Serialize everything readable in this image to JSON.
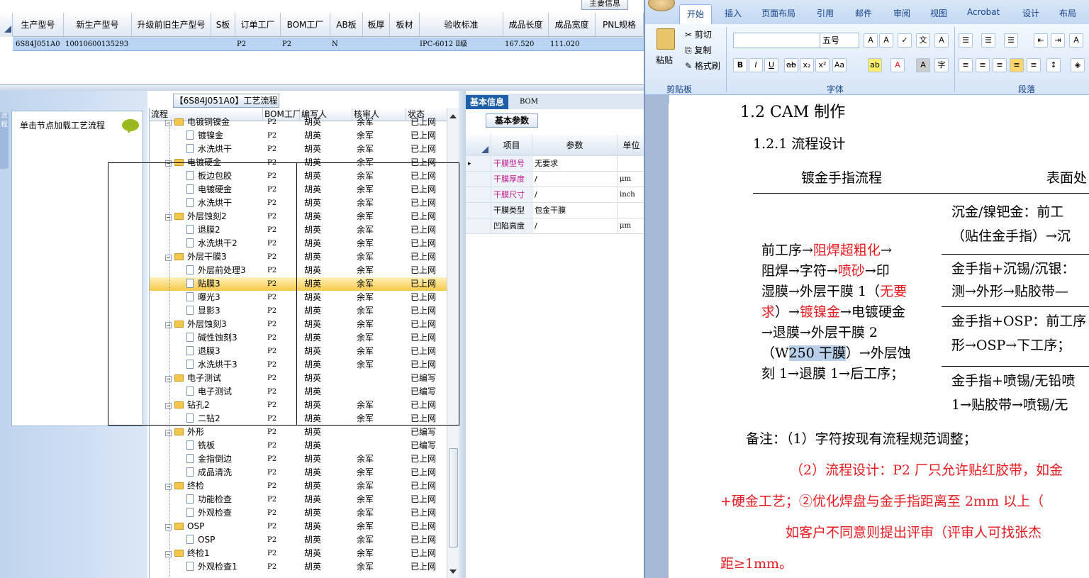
{
  "top_grid": {
    "tab": "主要信息",
    "headers": [
      "生产型号",
      "新生产型号",
      "升级前旧生产型号",
      "S板",
      "订单工厂",
      "BOM工厂",
      "AB板",
      "板厚",
      "板材",
      "验收标准",
      "成品长度",
      "成品宽度",
      "PNL规格"
    ],
    "row": [
      "6S84J051A0",
      "10010600135293",
      "",
      "",
      "P2",
      "P2",
      "N",
      "",
      "",
      "IPC-6012 Ⅱ级",
      "167.520",
      "111.020",
      ""
    ]
  },
  "left_panel": {
    "hint": "单击节点加载工艺流程",
    "side_tab": "流程"
  },
  "tree": {
    "title": "【6S84J051A0】工艺流程",
    "headers": [
      "流程",
      "BOM工厂",
      "编写人",
      "核审人",
      "状态"
    ],
    "rows": [
      {
        "level": 0,
        "type": "folder",
        "name": "电镀铜镍金",
        "bom": "P2",
        "writer": "胡英",
        "reviewer": "余军",
        "status": "已上网"
      },
      {
        "level": 1,
        "type": "doc",
        "name": "镀镍金",
        "bom": "P2",
        "writer": "胡英",
        "reviewer": "余军",
        "status": "已上网"
      },
      {
        "level": 1,
        "type": "doc",
        "name": "水洗烘干",
        "bom": "P2",
        "writer": "胡英",
        "reviewer": "余军",
        "status": "已上网"
      },
      {
        "level": 0,
        "type": "folder",
        "name": "电镀硬金",
        "bom": "P2",
        "writer": "胡英",
        "reviewer": "余军",
        "status": "已上网"
      },
      {
        "level": 1,
        "type": "doc",
        "name": "板边包胶",
        "bom": "P2",
        "writer": "胡英",
        "reviewer": "余军",
        "status": "已上网"
      },
      {
        "level": 1,
        "type": "doc",
        "name": "电镀硬金",
        "bom": "P2",
        "writer": "胡英",
        "reviewer": "余军",
        "status": "已上网"
      },
      {
        "level": 1,
        "type": "doc",
        "name": "水洗烘干",
        "bom": "P2",
        "writer": "胡英",
        "reviewer": "余军",
        "status": "已上网"
      },
      {
        "level": 0,
        "type": "folder",
        "name": "外层蚀刻2",
        "bom": "P2",
        "writer": "胡英",
        "reviewer": "余军",
        "status": "已上网"
      },
      {
        "level": 1,
        "type": "doc",
        "name": "退膜2",
        "bom": "P2",
        "writer": "胡英",
        "reviewer": "余军",
        "status": "已上网"
      },
      {
        "level": 1,
        "type": "doc",
        "name": "水洗烘干2",
        "bom": "P2",
        "writer": "胡英",
        "reviewer": "余军",
        "status": "已上网"
      },
      {
        "level": 0,
        "type": "folder",
        "name": "外层干膜3",
        "bom": "P2",
        "writer": "胡英",
        "reviewer": "余军",
        "status": "已上网"
      },
      {
        "level": 1,
        "type": "doc",
        "name": "外层前处理3",
        "bom": "P2",
        "writer": "胡英",
        "reviewer": "余军",
        "status": "已上网"
      },
      {
        "level": 1,
        "type": "doc",
        "name": "贴膜3",
        "bom": "P2",
        "writer": "胡英",
        "reviewer": "余军",
        "status": "已上网",
        "selected": true
      },
      {
        "level": 1,
        "type": "doc",
        "name": "曝光3",
        "bom": "P2",
        "writer": "胡英",
        "reviewer": "余军",
        "status": "已上网"
      },
      {
        "level": 1,
        "type": "doc",
        "name": "显影3",
        "bom": "P2",
        "writer": "胡英",
        "reviewer": "余军",
        "status": "已上网"
      },
      {
        "level": 0,
        "type": "folder",
        "name": "外层蚀刻3",
        "bom": "P2",
        "writer": "胡英",
        "reviewer": "余军",
        "status": "已上网"
      },
      {
        "level": 1,
        "type": "doc",
        "name": "碱性蚀刻3",
        "bom": "P2",
        "writer": "胡英",
        "reviewer": "余军",
        "status": "已上网"
      },
      {
        "level": 1,
        "type": "doc",
        "name": "退膜3",
        "bom": "P2",
        "writer": "胡英",
        "reviewer": "余军",
        "status": "已上网"
      },
      {
        "level": 1,
        "type": "doc",
        "name": "水洗烘干3",
        "bom": "P2",
        "writer": "胡英",
        "reviewer": "余军",
        "status": "已上网"
      },
      {
        "level": 0,
        "type": "folder",
        "name": "电子测试",
        "bom": "P2",
        "writer": "胡英",
        "reviewer": "",
        "status": "已编写"
      },
      {
        "level": 1,
        "type": "doc",
        "name": "电子测试",
        "bom": "P2",
        "writer": "胡英",
        "reviewer": "",
        "status": "已编写"
      },
      {
        "level": 0,
        "type": "folder",
        "name": "钻孔2",
        "bom": "P2",
        "writer": "胡英",
        "reviewer": "余军",
        "status": "已上网"
      },
      {
        "level": 1,
        "type": "doc",
        "name": "二钻2",
        "bom": "P2",
        "writer": "胡英",
        "reviewer": "余军",
        "status": "已上网"
      },
      {
        "level": 0,
        "type": "folder",
        "name": "外形",
        "bom": "P2",
        "writer": "胡英",
        "reviewer": "",
        "status": "已编写"
      },
      {
        "level": 1,
        "type": "doc",
        "name": "铣板",
        "bom": "P2",
        "writer": "胡英",
        "reviewer": "",
        "status": "已编写"
      },
      {
        "level": 1,
        "type": "doc",
        "name": "金指倒边",
        "bom": "P2",
        "writer": "胡英",
        "reviewer": "余军",
        "status": "已上网"
      },
      {
        "level": 1,
        "type": "doc",
        "name": "成品清洗",
        "bom": "P2",
        "writer": "胡英",
        "reviewer": "余军",
        "status": "已上网"
      },
      {
        "level": 0,
        "type": "folder",
        "name": "终检",
        "bom": "P2",
        "writer": "胡英",
        "reviewer": "余军",
        "status": "已上网"
      },
      {
        "level": 1,
        "type": "doc",
        "name": "功能检查",
        "bom": "P2",
        "writer": "胡英",
        "reviewer": "余军",
        "status": "已上网"
      },
      {
        "level": 1,
        "type": "doc",
        "name": "外观检查",
        "bom": "P2",
        "writer": "胡英",
        "reviewer": "余军",
        "status": "已上网"
      },
      {
        "level": 0,
        "type": "folder",
        "name": "OSP",
        "bom": "P2",
        "writer": "胡英",
        "reviewer": "余军",
        "status": "已上网"
      },
      {
        "level": 1,
        "type": "doc",
        "name": "OSP",
        "bom": "P2",
        "writer": "胡英",
        "reviewer": "余军",
        "status": "已上网"
      },
      {
        "level": 0,
        "type": "folder",
        "name": "终检1",
        "bom": "P2",
        "writer": "胡英",
        "reviewer": "余军",
        "status": "已上网"
      },
      {
        "level": 1,
        "type": "doc",
        "name": "外观检查1",
        "bom": "P2",
        "writer": "胡英",
        "reviewer": "余军",
        "status": "已上网"
      }
    ]
  },
  "info": {
    "tabs": [
      "基本信息",
      "BOM"
    ],
    "subtab": "基本参数",
    "headers": [
      "项目",
      "参数",
      "单位"
    ],
    "rows": [
      {
        "item": "干膜型号",
        "value": "无要求",
        "unit": "",
        "pink": true
      },
      {
        "item": "干膜厚度",
        "value": "/",
        "unit": "μm",
        "pink": true
      },
      {
        "item": "干膜尺寸",
        "value": "/",
        "unit": "inch",
        "pink": true
      },
      {
        "item": "干膜类型",
        "value": "包金干膜",
        "unit": "",
        "pink": false
      },
      {
        "item": "凹陷高度",
        "value": "/",
        "unit": "μm",
        "pink": false
      }
    ]
  },
  "word": {
    "tabs": [
      "开始",
      "插入",
      "页面布局",
      "引用",
      "邮件",
      "审阅",
      "视图",
      "Acrobat",
      "设计",
      "布局"
    ],
    "clipboard": {
      "paste": "粘贴",
      "cut": "剪切",
      "copy": "复制",
      "format": "格式刷",
      "group": "剪贴板"
    },
    "font": {
      "size": "五号",
      "group": "字体"
    },
    "para": {
      "group": "段落"
    },
    "heading1": "1.2  CAM 制作",
    "heading2": "1.2.1 流程设计",
    "table_head_left": "镀金手指流程",
    "table_head_right": "表面处",
    "cell_lines": [
      "前工序→阻焊超粗化→",
      "阻焊→字符→喷砂→印",
      "湿膜→外层干膜 1（无要",
      "求）→镀镍金→电镀硬金",
      "→退膜→外层干膜 2",
      "（W250 干膜）→外层蚀",
      "刻 1→退膜 1→后工序；"
    ],
    "right_cells": [
      "沉金/镍钯金：前工",
      "（贴住金手指）→沉",
      "金手指+沉锡/沉银：",
      "测→外形→贴胶带—",
      "金手指+OSP：前工序",
      "形→OSP→下工序；",
      "金手指+喷锡/无铅喷",
      "1→贴胶带→喷锡/无"
    ],
    "note1": "备注：（1）字符按现有流程规范调整；",
    "note2": "（2）流程设计：P2 厂只允许贴红胶带，如金",
    "note3": "+硬金工艺；②优化焊盘与金手指距离至 2mm 以上（",
    "note4": "如客户不同意则提出评审（评审人可找张杰",
    "note5": "距≥1mm。"
  }
}
